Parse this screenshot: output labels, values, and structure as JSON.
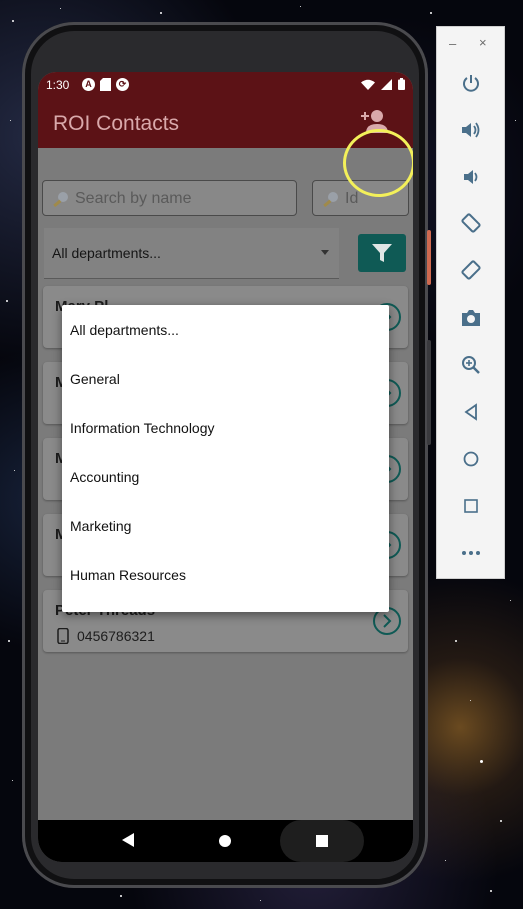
{
  "status_bar": {
    "time": "1:30",
    "icons": [
      "a-circle-icon",
      "sd-card-icon",
      "sync-circle-icon",
      "wifi-icon",
      "signal-icon",
      "battery-icon"
    ]
  },
  "app_bar": {
    "title": "ROI Contacts",
    "add_contact_icon": "add-person-icon"
  },
  "search": {
    "name_placeholder": "Search by name",
    "id_placeholder": "Id"
  },
  "department_filter": {
    "selected": "All departments...",
    "filter_button_icon": "funnel-icon"
  },
  "contacts": [
    {
      "name": "Mary Pl",
      "phone": ""
    },
    {
      "name": "M",
      "phone": ""
    },
    {
      "name": "M",
      "phone": ""
    },
    {
      "name": "M",
      "phone": ""
    },
    {
      "name": "Peter Threads",
      "phone": "0456786321"
    }
  ],
  "department_options": [
    "All departments...",
    "General",
    "Information Technology",
    "Accounting",
    "Marketing",
    "Human Resources"
  ],
  "colors": {
    "app_bar": "#5c1216",
    "filter_button": "#0f5a55",
    "highlight_circle": "#f3f05a",
    "chevron": "#0f5a55"
  },
  "emulator_toolbar": {
    "minimize": "–",
    "close": "×",
    "buttons": [
      "power-icon",
      "volume-up-icon",
      "volume-down-icon",
      "rotate-left-icon",
      "rotate-right-icon",
      "camera-icon",
      "zoom-icon",
      "back-icon",
      "home-icon",
      "overview-icon",
      "more-icon"
    ]
  }
}
